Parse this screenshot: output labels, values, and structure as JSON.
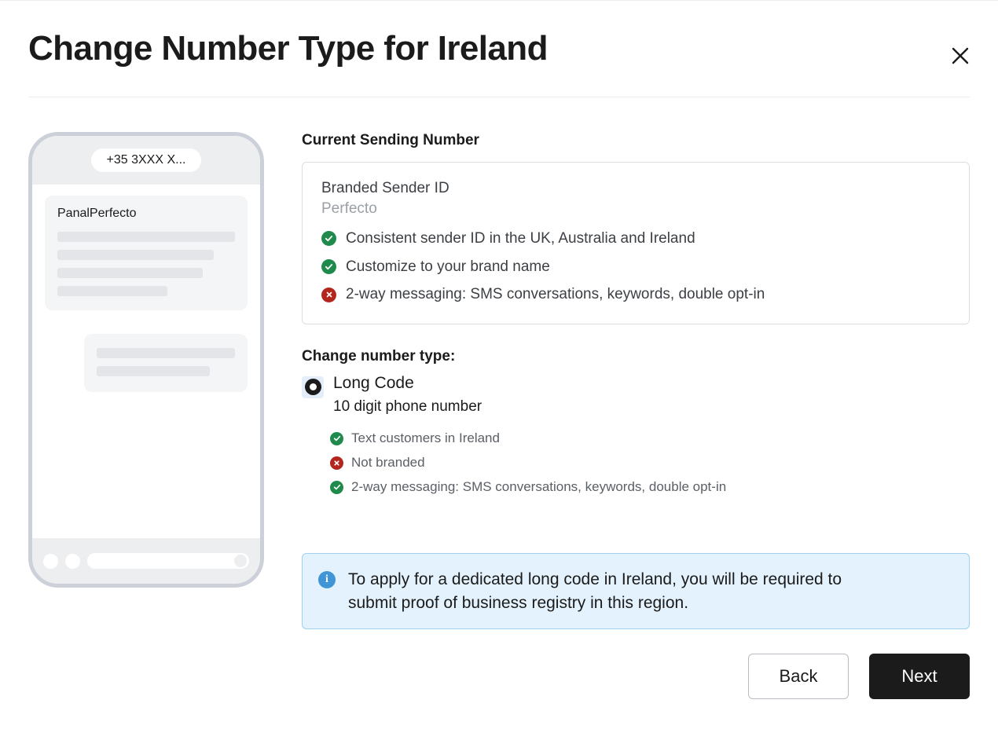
{
  "header": {
    "title": "Change Number Type for Ireland",
    "close_icon": "close-icon"
  },
  "phone_preview": {
    "number_pill": "+35 3XXX X...",
    "message_sender": "PanalPerfecto",
    "skeleton_widths_pct": [
      100,
      88,
      82,
      62
    ],
    "skeleton_widths_pct_second": [
      100,
      82
    ]
  },
  "current_sending_number": {
    "label": "Current Sending Number",
    "type_name": "Branded Sender ID",
    "value": "Perfecto",
    "features": [
      {
        "status": "ok",
        "text": "Consistent sender ID in the UK, Australia and Ireland"
      },
      {
        "status": "ok",
        "text": "Customize to your brand name"
      },
      {
        "status": "no",
        "text": "2-way messaging: SMS conversations, keywords, double opt-in"
      }
    ]
  },
  "change_number_type": {
    "label": "Change number type:",
    "options": [
      {
        "label": "Long Code",
        "description": "10 digit phone number",
        "selected": true,
        "features": [
          {
            "status": "ok",
            "text": "Text customers in Ireland"
          },
          {
            "status": "no",
            "text": "Not branded"
          },
          {
            "status": "ok",
            "text": "2-way messaging: SMS conversations, keywords, double opt-in"
          }
        ]
      }
    ]
  },
  "info_banner": {
    "icon": "info-icon",
    "text": "To apply for a dedicated long code in Ireland, you will be required to submit proof of business registry in this region."
  },
  "footer": {
    "back_label": "Back",
    "next_label": "Next"
  },
  "colors": {
    "success": "#1f8a4c",
    "error": "#b3261e",
    "info": "#3f95d6",
    "info_bg": "#e3f2fc",
    "primary_button": "#1b1b1b"
  }
}
